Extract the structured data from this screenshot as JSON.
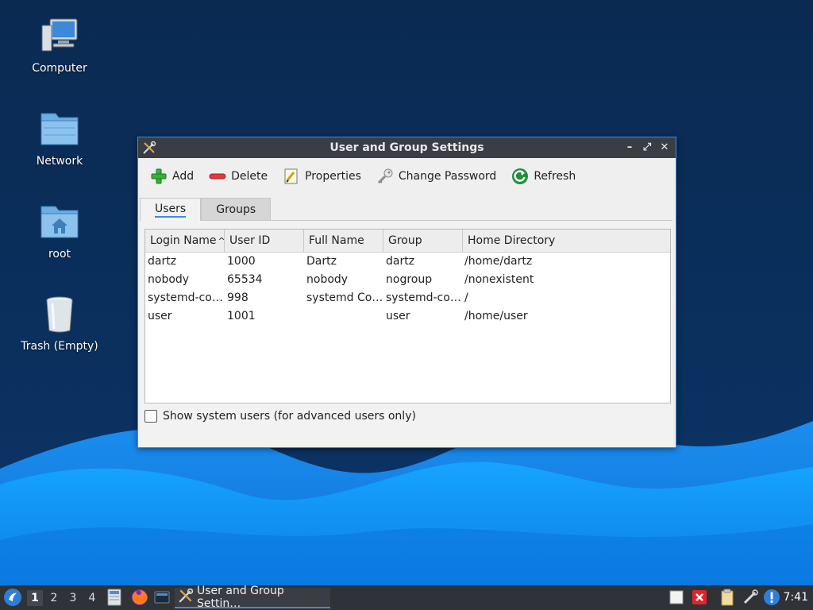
{
  "desktop": {
    "icons": [
      {
        "label": "Computer",
        "icon": "computer-icon"
      },
      {
        "label": "Network",
        "icon": "network-folder-icon"
      },
      {
        "label": "root",
        "icon": "home-folder-icon"
      },
      {
        "label": "Trash (Empty)",
        "icon": "trash-icon"
      }
    ]
  },
  "window": {
    "title": "User and Group Settings",
    "app_icon": "tools-icon",
    "controls": {
      "minimize": "–",
      "maximize": "⤢",
      "close": "✕"
    },
    "toolbar": [
      {
        "label": "Add",
        "icon": "add-icon"
      },
      {
        "label": "Delete",
        "icon": "delete-icon"
      },
      {
        "label": "Properties",
        "icon": "properties-icon"
      },
      {
        "label": "Change Password",
        "icon": "key-icon"
      },
      {
        "label": "Refresh",
        "icon": "refresh-icon"
      }
    ],
    "tabs": [
      {
        "label": "Users",
        "active": true
      },
      {
        "label": "Groups",
        "active": false
      }
    ],
    "table": {
      "columns": [
        "Login Name",
        "User ID",
        "Full Name",
        "Group",
        "Home Directory"
      ],
      "sort_column": "Login Name",
      "sort_direction": "ascending",
      "rows": [
        [
          "dartz",
          "1000",
          "Dartz",
          "dartz",
          "/home/dartz"
        ],
        [
          "nobody",
          "65534",
          "nobody",
          "nogroup",
          "/nonexistent"
        ],
        [
          "systemd-co…",
          "998",
          "systemd Co…",
          "systemd-co…",
          "/"
        ],
        [
          "user",
          "1001",
          "",
          "user",
          "/home/user"
        ]
      ]
    },
    "show_system_users": {
      "label": "Show system users (for advanced users only)",
      "checked": false
    }
  },
  "taskbar": {
    "menu_icon": "start-menu-icon",
    "workspaces": [
      "1",
      "2",
      "3",
      "4"
    ],
    "active_workspace": "1",
    "launchers": [
      "file-manager-icon",
      "firefox-icon",
      "terminal-icon"
    ],
    "task_item": {
      "label": "User and Group Settin…",
      "icon": "tools-icon"
    },
    "tray": [
      "notes-icon",
      "no-network-icon",
      "clipboard-icon",
      "pen-icon",
      "update-alert-icon"
    ],
    "clock": "7:41"
  },
  "colors": {
    "desktop_top": "#0a2a52",
    "wave_light": "#1a9af5",
    "wave_dark": "#0b63c9",
    "accent": "#3d8ee0",
    "titlebar": "#3a3e44",
    "taskbar": "#2f3236"
  }
}
